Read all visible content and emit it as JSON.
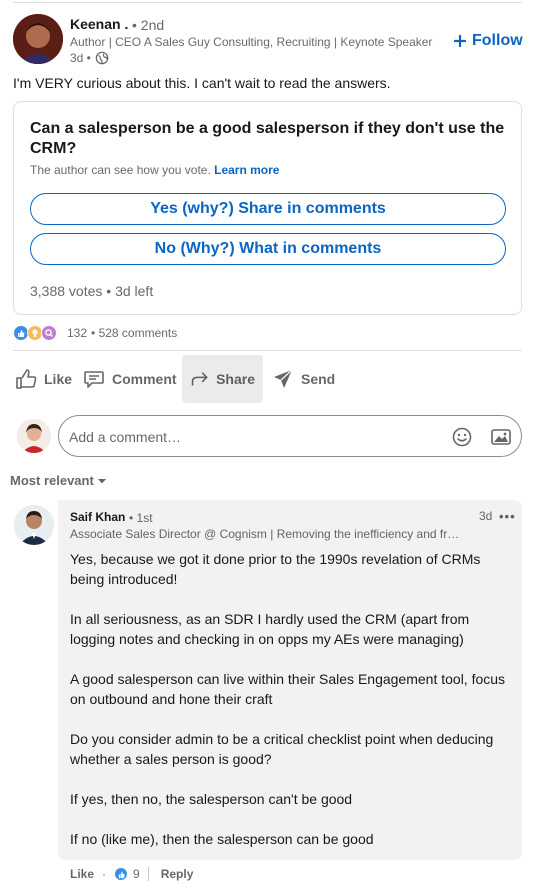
{
  "post": {
    "author_name": "Keenan .",
    "author_degree": "• 2nd",
    "author_headline": "Author | CEO A Sales Guy Consulting, Recruiting | Keynote Speaker",
    "time": "3d •",
    "follow_label": "Follow",
    "text": "I'm VERY curious about this. I can't wait to read the answers."
  },
  "poll": {
    "question": "Can a salesperson be a good salesperson if they don't use the CRM?",
    "note": "The author can see how you vote.",
    "learn_more": "Learn more",
    "options": [
      {
        "label": "Yes (why?) Share in comments"
      },
      {
        "label": "No (Why?) What in comments"
      }
    ],
    "meta": "3,388 votes • 3d left"
  },
  "social": {
    "reaction_icons": [
      "like-icon",
      "insightful-icon",
      "curious-icon"
    ],
    "reaction_count": "132",
    "comments": "• 528 comments"
  },
  "actions": {
    "like": "Like",
    "comment": "Comment",
    "share": "Share",
    "send": "Send"
  },
  "comment_box": {
    "placeholder": "Add a comment…"
  },
  "sort": {
    "label": "Most relevant"
  },
  "comment": {
    "name": "Saif Khan",
    "degree": "• 1st",
    "headline": "Associate Sales Director @ Cognism | Removing the inefficiency and frustration",
    "time": "3d",
    "more": "•••",
    "paragraphs": [
      "Yes, because we got it done prior to the 1990s revelation of CRMs being introduced!",
      "In all seriousness, as an SDR I hardly used the CRM (apart from logging notes and checking in on opps my AEs were managing)",
      "A good salesperson can live within their Sales Engagement tool, focus on outbound and hone their craft",
      "Do you consider admin to be a critical checklist point when deducing whether a sales person is good?",
      "If yes, then no, the salesperson can't be good",
      "If no (like me), then the salesperson can be good"
    ],
    "like_label": "Like",
    "reaction_count": "9",
    "reply_label": "Reply"
  },
  "colors": {
    "brand_blue": "#0a66c2",
    "muted_text": "rgba(0,0,0,0.6)",
    "bubble_bg": "#f2f2f2"
  }
}
